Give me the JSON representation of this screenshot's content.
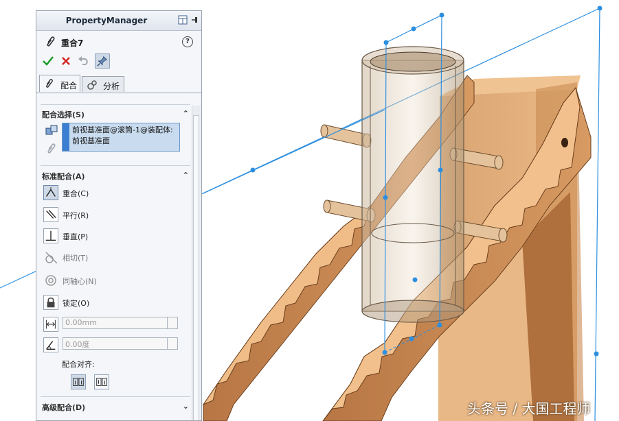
{
  "property_manager": {
    "title": "PropertyManager",
    "feature_name": "重合7",
    "help_symbol": "?",
    "tabs": [
      {
        "label": "配合",
        "active": true
      },
      {
        "label": "分析",
        "active": false
      }
    ],
    "mate_selections": {
      "header": "配合选择(S)",
      "items": [
        "前视基准面@滚筒-1@装配体:",
        "前视基准面"
      ]
    },
    "standard_mates": {
      "header": "标准配合(A)",
      "items": [
        {
          "label": "重合(C)",
          "icon": "coincident-icon",
          "selected": true,
          "enabled": true
        },
        {
          "label": "平行(R)",
          "icon": "parallel-icon",
          "selected": false,
          "enabled": true
        },
        {
          "label": "垂直(P)",
          "icon": "perpendicular-icon",
          "selected": false,
          "enabled": true
        },
        {
          "label": "相切(T)",
          "icon": "tangent-icon",
          "selected": false,
          "enabled": false
        },
        {
          "label": "同轴心(N)",
          "icon": "concentric-icon",
          "selected": false,
          "enabled": false
        },
        {
          "label": "锁定(O)",
          "icon": "lock-icon",
          "selected": false,
          "enabled": true
        }
      ],
      "distance_value": "0.00mm",
      "angle_value": "0.00度",
      "alignment_label": "配合对齐:"
    },
    "advanced_mates": {
      "header": "高级配合(D)"
    }
  },
  "watermark": "头条号 / 大国工程师",
  "colors": {
    "accent_blue": "#3c7fd2",
    "wood": "#c98a52",
    "sketch_line": "#2d8fe0",
    "confirm_green": "#1e9a2a",
    "cancel_red": "#d42020"
  }
}
